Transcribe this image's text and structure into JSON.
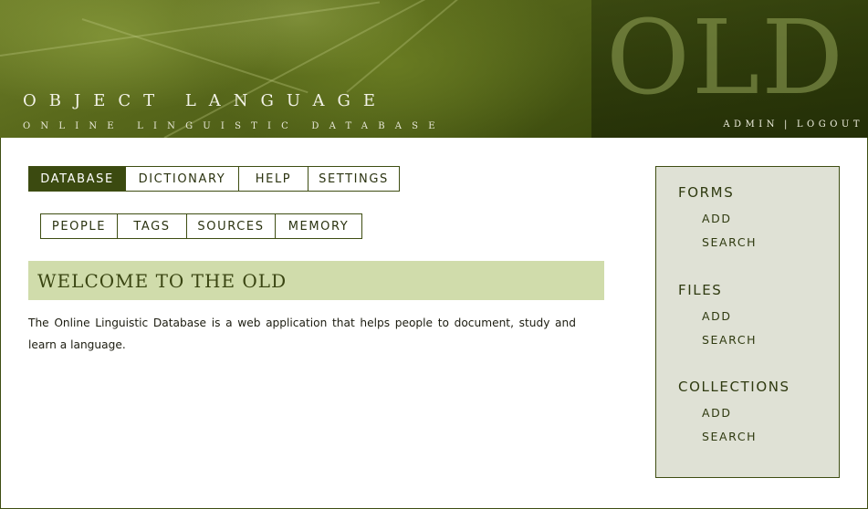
{
  "header": {
    "title": "OBJECT LANGUAGE",
    "subtitle": "ONLINE LINGUISTIC DATABASE",
    "logo_text": "OLD",
    "account": {
      "admin": "ADMIN",
      "separator": "|",
      "logout": "LOGOUT"
    }
  },
  "main_tabs": [
    {
      "label": "DATABASE",
      "active": true
    },
    {
      "label": "DICTIONARY",
      "active": false
    },
    {
      "label": "HELP",
      "active": false
    },
    {
      "label": "SETTINGS",
      "active": false
    }
  ],
  "sub_tabs": [
    {
      "label": "PEOPLE"
    },
    {
      "label": "TAGS"
    },
    {
      "label": "SOURCES"
    },
    {
      "label": "MEMORY"
    }
  ],
  "content": {
    "heading": "WELCOME TO THE OLD",
    "intro": "The Online Linguistic Database is a web application that helps people to document, study and learn a language."
  },
  "sidebar": {
    "groups": [
      {
        "title": "FORMS",
        "links": [
          "ADD",
          "SEARCH"
        ]
      },
      {
        "title": "FILES",
        "links": [
          "ADD",
          "SEARCH"
        ]
      },
      {
        "title": "COLLECTIONS",
        "links": [
          "ADD",
          "SEARCH"
        ]
      }
    ]
  },
  "colors": {
    "accent_dark": "#3b4a10",
    "heading_bar": "#d0dcab",
    "sidebar_bg": "#dfe1d5"
  }
}
